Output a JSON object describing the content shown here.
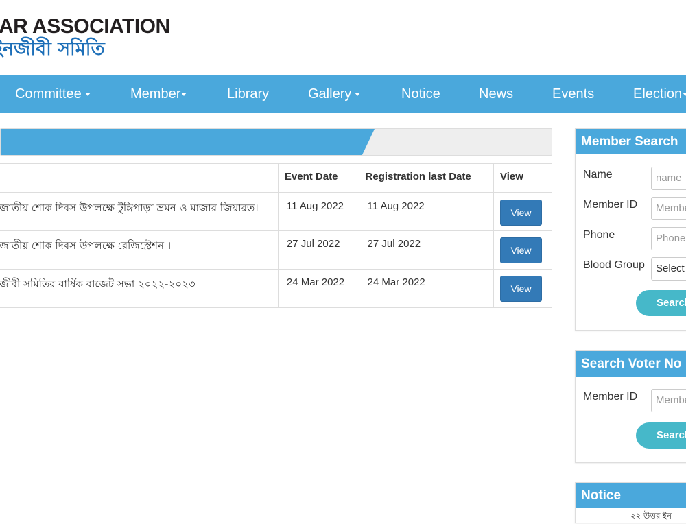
{
  "header": {
    "logo_en": "AR ASSOCIATION",
    "logo_bn": "ইনজীবী সমিতি"
  },
  "nav": {
    "items": [
      {
        "label": "Committee",
        "dropdown": true
      },
      {
        "label": "Member",
        "dropdown": true
      },
      {
        "label": "Library",
        "dropdown": false
      },
      {
        "label": "Gallery",
        "dropdown": true
      },
      {
        "label": "Notice",
        "dropdown": false
      },
      {
        "label": "News",
        "dropdown": false
      },
      {
        "label": "Events",
        "dropdown": false
      },
      {
        "label": "Election",
        "dropdown": true
      }
    ]
  },
  "events_table": {
    "headers": [
      "",
      "Event Date",
      "Registration last Date",
      "View"
    ],
    "rows": [
      {
        "title": "জাতীয় শোক দিবস উপলক্ষে টুঙ্গিপাড়া ভ্রমন ও মাজার জিয়ারত।",
        "event_date": "11 Aug 2022",
        "reg_date": "11 Aug 2022",
        "view": "View"
      },
      {
        "title": "জাতীয় শোক দিবস উপলক্ষে রেজিস্ট্রেশন ।",
        "event_date": "27 Jul 2022",
        "reg_date": "27 Jul 2022",
        "view": "View"
      },
      {
        "title": "জীবী সমিতির বার্ষিক বাজেট সভা ২০২২-২০২৩",
        "event_date": "24 Mar 2022",
        "reg_date": "24 Mar 2022",
        "view": "View"
      }
    ]
  },
  "member_search": {
    "title": "Member Search",
    "name_label": "Name",
    "name_placeholder": "name",
    "id_label": "Member ID",
    "id_placeholder": "Member",
    "phone_label": "Phone",
    "phone_placeholder": "Phone",
    "blood_label": "Blood Group",
    "blood_selected": "Select",
    "search_button": "Search"
  },
  "voter_search": {
    "title": "Search Voter No",
    "id_label": "Member ID",
    "id_placeholder": "Member",
    "search_button": "Search"
  },
  "notice": {
    "title": "Notice",
    "sub": "২২ উত্তর ইন"
  },
  "colors": {
    "primary": "#4aa8dc",
    "view_button": "#337ab7",
    "search_button": "#46b8c9",
    "logo_blue": "#1d6fb8"
  }
}
